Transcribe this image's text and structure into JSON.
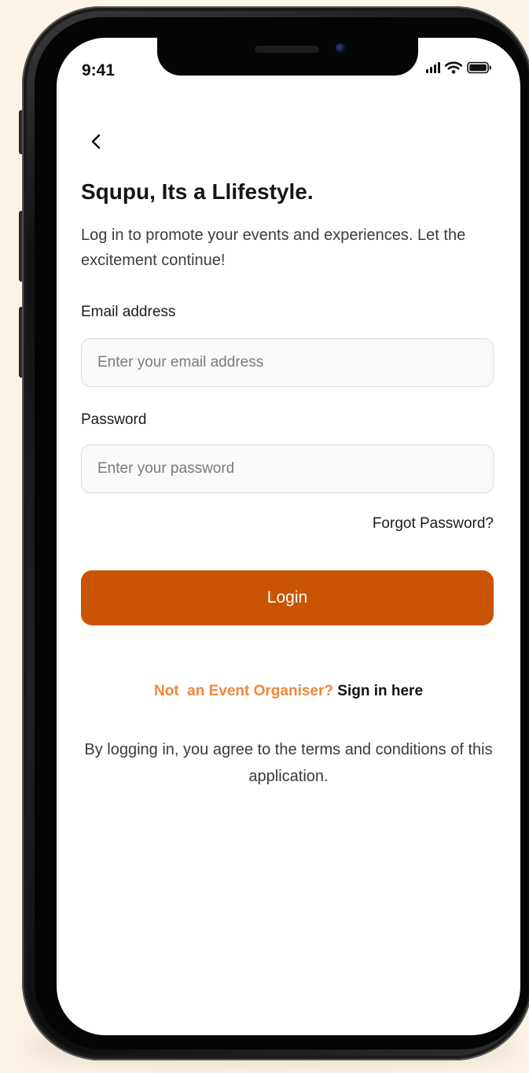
{
  "status_bar": {
    "time": "9:41",
    "signal_icon": "signal-bars-icon",
    "wifi_icon": "wifi-icon",
    "battery_icon": "battery-icon"
  },
  "header": {
    "back_icon": "chevron-left-icon",
    "title": "Squpu, Its a Llifestyle.",
    "subtitle": "Log in to promote your events and experiences. Let the excitement continue!"
  },
  "form": {
    "email_label": "Email address",
    "email_placeholder": "Enter your email address",
    "email_value": "",
    "password_label": "Password",
    "password_placeholder": "Enter your password",
    "password_value": "",
    "forgot_password": "Forgot Password?",
    "login_button": "Login"
  },
  "organiser": {
    "prompt": "Not  an Event Organiser?",
    "link": "Sign in here"
  },
  "footer": {
    "terms": "By logging in, you agree to the terms and conditions of this application."
  },
  "colors": {
    "accent": "#c95403",
    "prompt_orange": "#f0873c",
    "background": "#fbf3e6"
  }
}
